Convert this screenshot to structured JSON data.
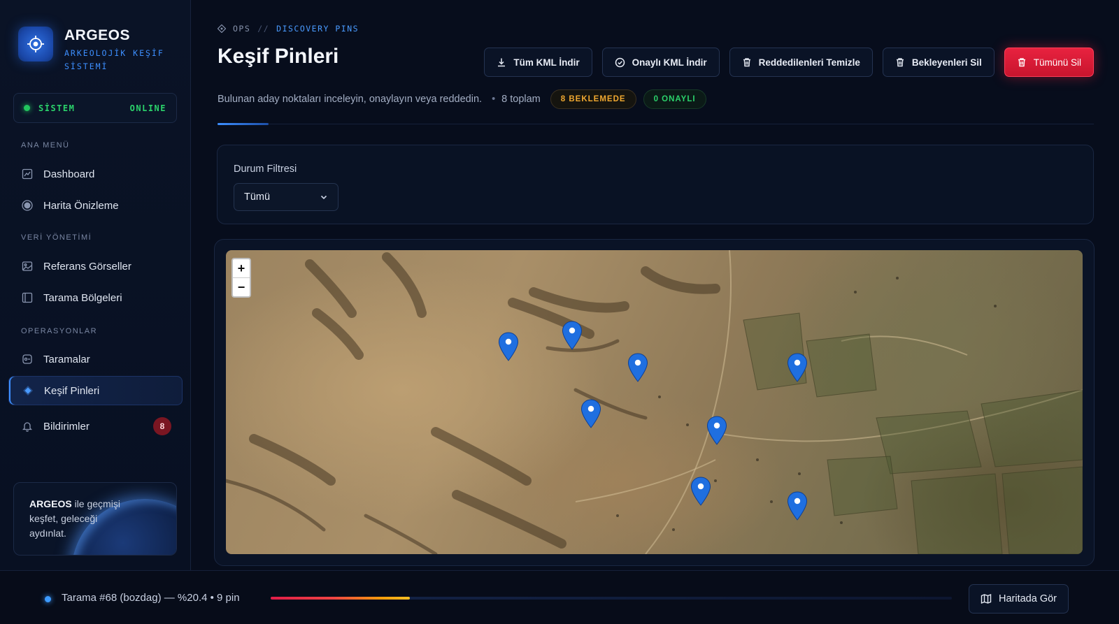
{
  "brand": {
    "name": "ARGEOS",
    "subtitle": "ARKEOLOJİK KEŞİF SİSTEMİ"
  },
  "system_status": {
    "label": "SİSTEM",
    "value": "ONLINE"
  },
  "sidebar": {
    "sections": [
      {
        "title": "ANA MENÜ"
      },
      {
        "title": "VERİ YÖNETİMİ"
      },
      {
        "title": "OPERASYONLAR"
      }
    ],
    "items": [
      {
        "label": "Dashboard",
        "icon": "chart-icon"
      },
      {
        "label": "Harita Önizleme",
        "icon": "globe-icon"
      },
      {
        "label": "Referans Görseller",
        "icon": "image-icon"
      },
      {
        "label": "Tarama Bölgeleri",
        "icon": "region-icon"
      },
      {
        "label": "Taramalar",
        "icon": "scan-icon"
      },
      {
        "label": "Keşif Pinleri",
        "icon": "diamond-pin-icon",
        "active": true
      },
      {
        "label": "Bildirimler",
        "icon": "bell-icon",
        "badge": "8"
      }
    ]
  },
  "promo": {
    "brand": "ARGEOS",
    "rest": " ile geçmişi keşfet, geleceği aydınlat."
  },
  "breadcrumb": {
    "root": "OPS",
    "separator": "//",
    "current": "DISCOVERY PINS"
  },
  "page": {
    "title": "Keşif Pinleri",
    "description": "Bulunan aday noktaları inceleyin, onaylayın veya reddedin.",
    "total": "8 toplam",
    "pending_badge": "8 BEKLEMEDE",
    "approved_badge": "0 ONAYLI"
  },
  "toolbar": {
    "download_all": "Tüm KML İndir",
    "download_approved": "Onaylı KML İndir",
    "clear_rejected": "Reddedilenleri Temizle",
    "delete_pending": "Bekleyenleri Sil",
    "delete_all": "Tümünü Sil"
  },
  "filter": {
    "label": "Durum Filtresi",
    "selected": "Tümü"
  },
  "map": {
    "zoom_in": "+",
    "zoom_out": "−",
    "pin_count": 8,
    "pin_color": "#1f6fe0"
  },
  "bottom": {
    "scan_text": "Tarama #68 (bozdag) — %20.4 • 9 pin",
    "progress": 0.204,
    "map_button": "Haritada Gör"
  },
  "colors": {
    "accent": "#3d8fff",
    "danger": "#e11d48",
    "success": "#22c55e",
    "warning": "#f0a830",
    "background": "#070d1c"
  }
}
